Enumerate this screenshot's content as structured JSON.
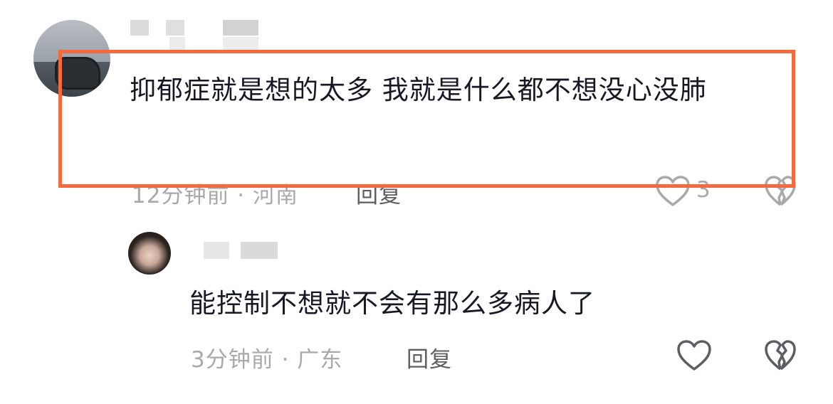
{
  "comments": [
    {
      "text": "抑郁症就是想的太多   我就是什么都不想没心没肺",
      "meta": "12分钟前 · 河南",
      "reply_label": "回复",
      "like_count": "3",
      "like_icon": "heart-outline-icon",
      "dislike_icon": "broken-heart-icon"
    },
    {
      "text": "能控制不想就不会有那么多病人了",
      "meta": "3分钟前 · 广东",
      "reply_label": "回复",
      "like_icon": "heart-outline-icon",
      "dislike_icon": "broken-heart-icon"
    }
  ],
  "colors": {
    "highlight_border": "#f26a3d",
    "text": "#161823",
    "meta": "#a8a9ad",
    "reply": "#5d5e63"
  }
}
